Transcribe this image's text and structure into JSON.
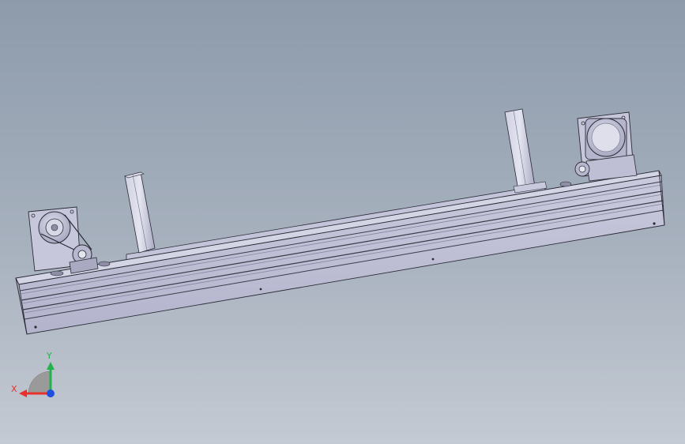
{
  "viewport": {
    "background_top": "#8d9bab",
    "background_bottom": "#c4cad3",
    "model": "conveyor-assembly"
  },
  "colors": {
    "part_face": "#bfc0d6",
    "part_dark": "#8f90a8",
    "edge": "#2b2b36",
    "axis_x": "#e8312b",
    "axis_y": "#22b24c",
    "axis_z": "#1e4fe0"
  },
  "triad": {
    "x_label": "X",
    "y_label": "Y"
  }
}
